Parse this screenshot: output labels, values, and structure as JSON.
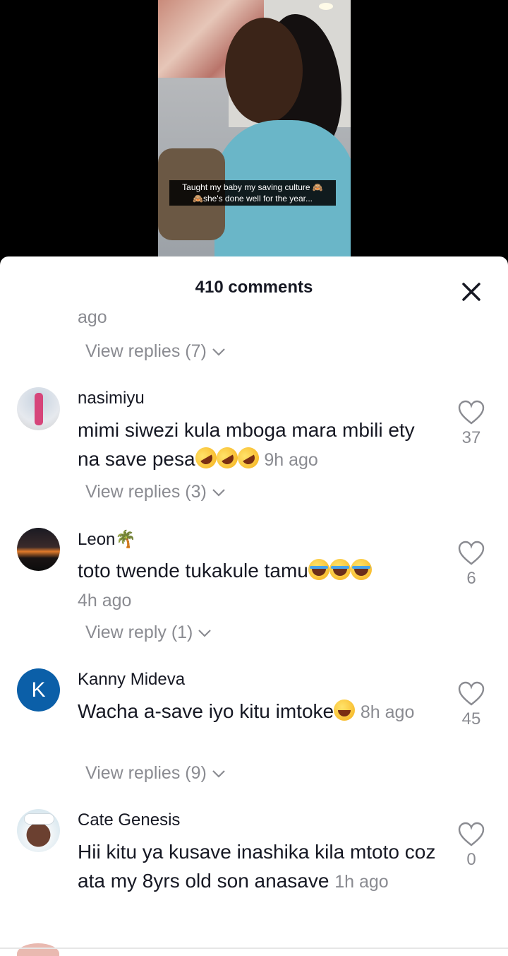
{
  "video": {
    "caption_line1": "Taught my baby my saving culture 🙈",
    "caption_line2": "🙈she's done well for the year..."
  },
  "sheet": {
    "title": "410 comments",
    "partial_time": "ago",
    "first_view_replies": "View replies (7)"
  },
  "comments": [
    {
      "username": "nasimiyu",
      "text": "mimi siwezi kula mboga mara mbili ety na save pesa",
      "time": "9h ago",
      "likes": "37",
      "replies": "View replies (3)"
    },
    {
      "username": "Leon🌴",
      "text": "toto twende tukakule tamu",
      "time": "4h ago",
      "likes": "6",
      "replies": "View reply (1)"
    },
    {
      "username": "Kanny Mideva",
      "avatar_letter": "K",
      "text": "Wacha a-save iyo kitu imtoke",
      "time": "8h ago",
      "likes": "45",
      "replies": "View replies (9)"
    },
    {
      "username": "Cate Genesis",
      "text": "Hii kitu ya kusave inashika kila mtoto coz ata my 8yrs old son anasave",
      "time": "1h ago",
      "likes": "0"
    }
  ],
  "icons": {
    "close": "close-icon",
    "like": "heart-icon",
    "chevron": "chevron-down-icon"
  },
  "colors": {
    "text_primary": "#161823",
    "text_secondary": "#8a8b91",
    "avatar_k": "#0b5fa8"
  }
}
